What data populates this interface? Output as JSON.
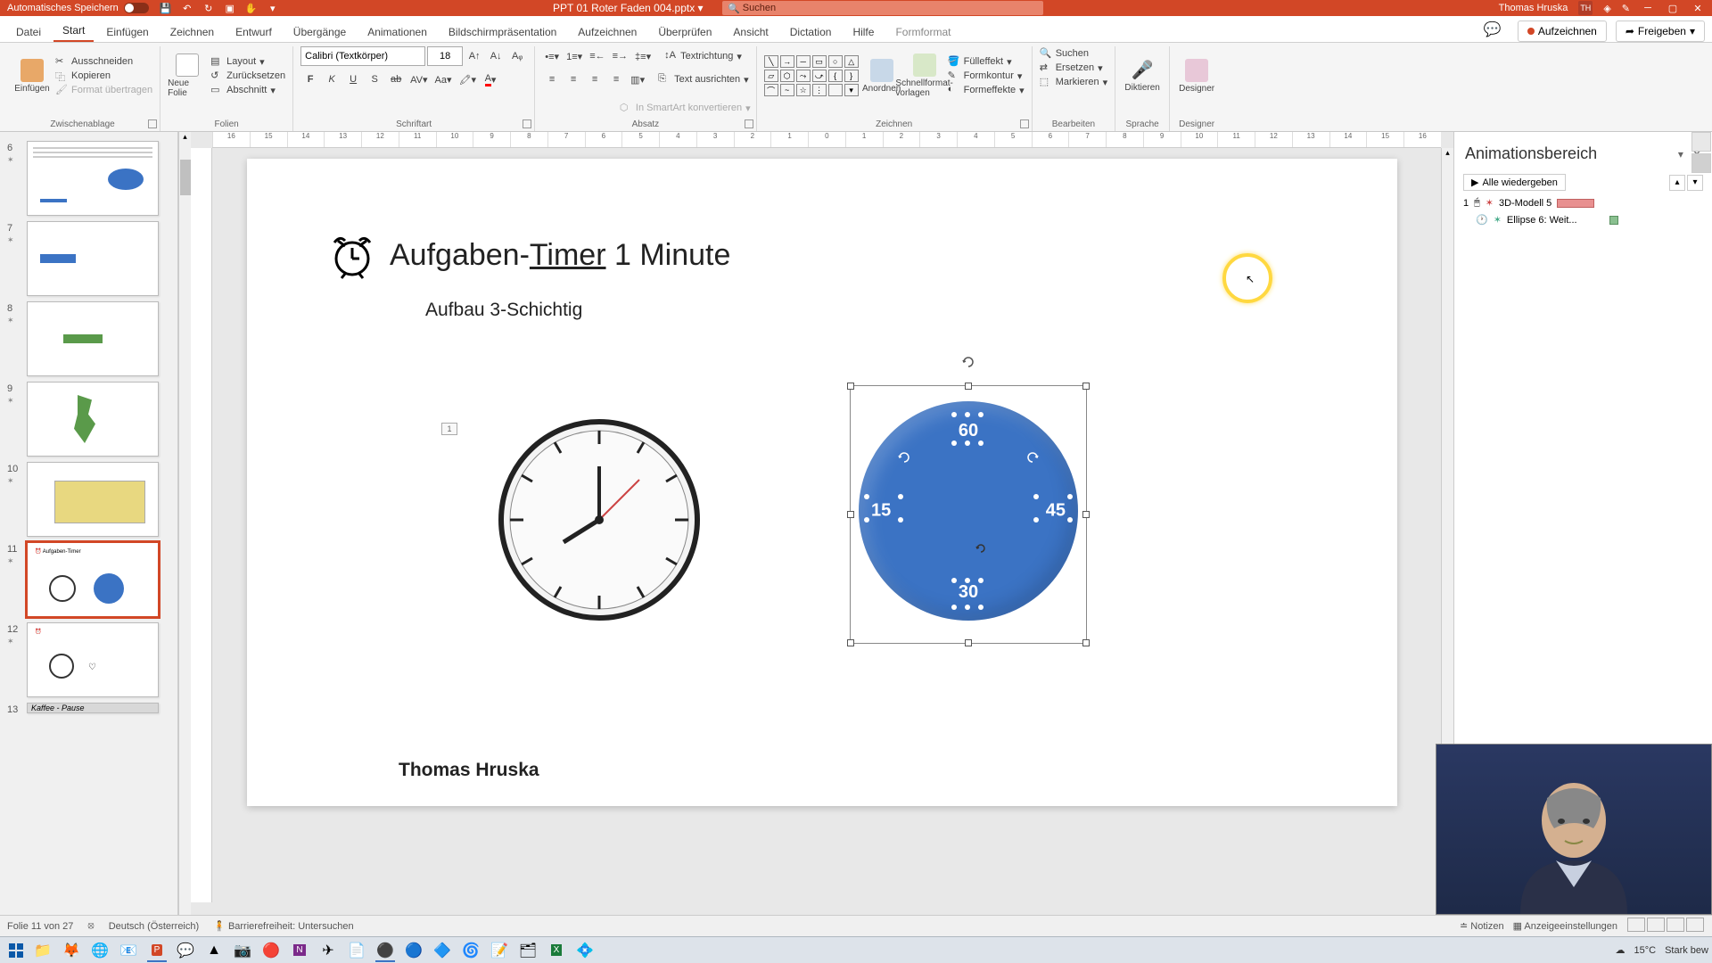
{
  "titlebar": {
    "autosave": "Automatisches Speichern",
    "filename": "PPT 01 Roter Faden 004.pptx",
    "search_placeholder": "Suchen",
    "username": "Thomas Hruska",
    "initials": "TH"
  },
  "tabs": {
    "datei": "Datei",
    "start": "Start",
    "einfuegen": "Einfügen",
    "zeichnen": "Zeichnen",
    "entwurf": "Entwurf",
    "uebergaenge": "Übergänge",
    "animationen": "Animationen",
    "bildschirm": "Bildschirmpräsentation",
    "aufzeichnen_tab": "Aufzeichnen",
    "ueberpruefen": "Überprüfen",
    "ansicht": "Ansicht",
    "dictation": "Dictation",
    "hilfe": "Hilfe",
    "formformat": "Formformat",
    "aufzeichnen_btn": "Aufzeichnen",
    "freigeben": "Freigeben"
  },
  "ribbon": {
    "groups": {
      "zwischenablage": "Zwischenablage",
      "folien": "Folien",
      "schriftart": "Schriftart",
      "absatz": "Absatz",
      "zeichnen": "Zeichnen",
      "bearbeiten": "Bearbeiten",
      "sprache": "Sprache",
      "designer": "Designer"
    },
    "einfuegen_btn": "Einfügen",
    "ausschneiden": "Ausschneiden",
    "kopieren": "Kopieren",
    "format_uebertragen": "Format übertragen",
    "neue_folie": "Neue Folie",
    "layout": "Layout",
    "zuruecksetzen": "Zurücksetzen",
    "abschnitt": "Abschnitt",
    "font_name": "Calibri (Textkörper)",
    "font_size": "18",
    "textrichtung": "Textrichtung",
    "text_ausrichten": "Text ausrichten",
    "smartart": "In SmartArt konvertieren",
    "anordnen": "Anordnen",
    "schnellformat": "Schnellformat-vorlagen",
    "fuelleffekt": "Fülleffekt",
    "formkontur": "Formkontur",
    "formeffekte": "Formeffekte",
    "suchen": "Suchen",
    "ersetzen": "Ersetzen",
    "markieren": "Markieren",
    "diktieren": "Diktieren",
    "designer_btn": "Designer"
  },
  "slides": {
    "s6": "6",
    "s7": "7",
    "s8": "8",
    "s9": "9",
    "s10": "10",
    "s11": "11",
    "s12": "12",
    "s13": "13",
    "s13label": "Kaffee - Pause"
  },
  "slide": {
    "title_pre": "Aufgaben-",
    "title_under": "Timer",
    "title_post": " 1 Minute",
    "subtitle": "Aufbau 3-Schichtig",
    "author": "Thomas Hruska",
    "onebox": "1",
    "n60": "60",
    "n45": "45",
    "n30": "30",
    "n15": "15"
  },
  "animpane": {
    "title": "Animationsbereich",
    "play_all": "Alle wiedergeben",
    "item1_num": "1",
    "item1": "3D-Modell 5",
    "item2": "Ellipse 6: Weit..."
  },
  "statusbar": {
    "slide_count": "Folie 11 von 27",
    "language": "Deutsch (Österreich)",
    "accessibility": "Barrierefreiheit: Untersuchen",
    "notizen": "Notizen",
    "anzeige": "Anzeigeeinstellungen"
  },
  "taskbar": {
    "temp": "15°C",
    "weather": "Stark bew"
  }
}
